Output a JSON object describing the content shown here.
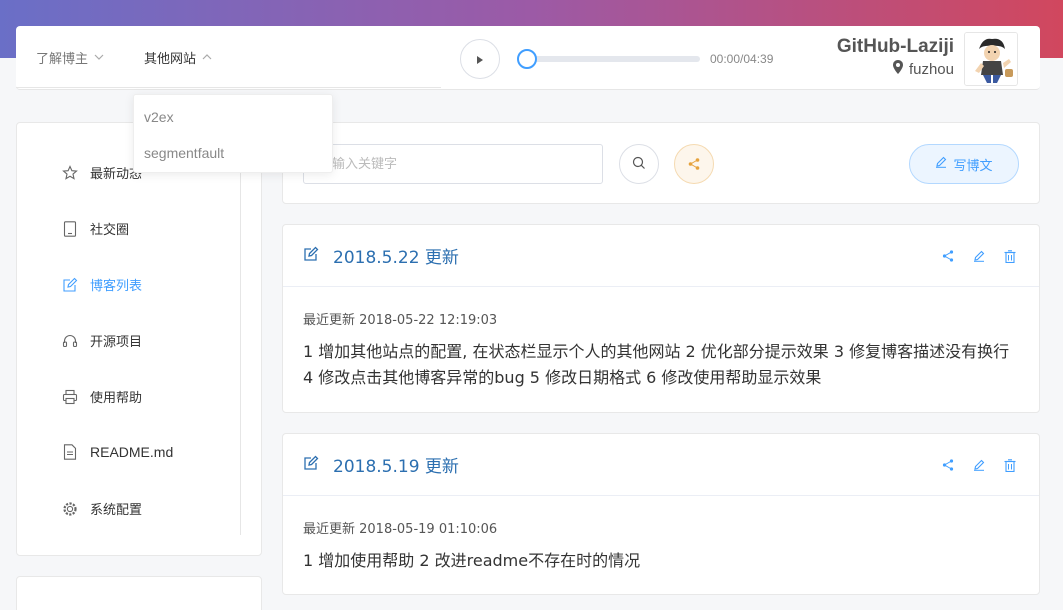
{
  "nav": {
    "items": [
      {
        "label": "了解博主",
        "open": false
      },
      {
        "label": "其他网站",
        "open": true
      }
    ],
    "dropdown": [
      "v2ex",
      "segmentfault"
    ]
  },
  "player": {
    "time": "00:00/04:39",
    "progress": 0
  },
  "user": {
    "name": "GitHub-Laziji",
    "location": "fuzhou"
  },
  "sidebar": {
    "items": [
      {
        "label": "最新动态",
        "icon": "star-icon",
        "active": false
      },
      {
        "label": "社交圈",
        "icon": "tablet-icon",
        "active": false
      },
      {
        "label": "博客列表",
        "icon": "edit-icon",
        "active": true
      },
      {
        "label": "开源项目",
        "icon": "headset-icon",
        "active": false
      },
      {
        "label": "使用帮助",
        "icon": "printer-icon",
        "active": false
      },
      {
        "label": "README.md",
        "icon": "document-icon",
        "active": false
      },
      {
        "label": "系统配置",
        "icon": "gear-icon",
        "active": false
      }
    ]
  },
  "toolbar": {
    "search_placeholder": "输入关键字",
    "write_label": "写博文"
  },
  "posts": [
    {
      "title": "2018.5.22 更新",
      "meta": "最近更新 2018-05-22 12:19:03",
      "content": "1 增加其他站点的配置, 在状态栏显示个人的其他网站 2 优化部分提示效果 3 修复博客描述没有换行 4 修改点击其他博客异常的bug 5 修改日期格式 6 修改使用帮助显示效果"
    },
    {
      "title": "2018.5.19 更新",
      "meta": "最近更新 2018-05-19 01:10:06",
      "content": "1 增加使用帮助 2 改进readme不存在时的情况"
    }
  ],
  "colors": {
    "accent": "#409eff",
    "title": "#2c6fb0",
    "gradient_start": "#6a6fc7",
    "gradient_end": "#d1475e"
  }
}
